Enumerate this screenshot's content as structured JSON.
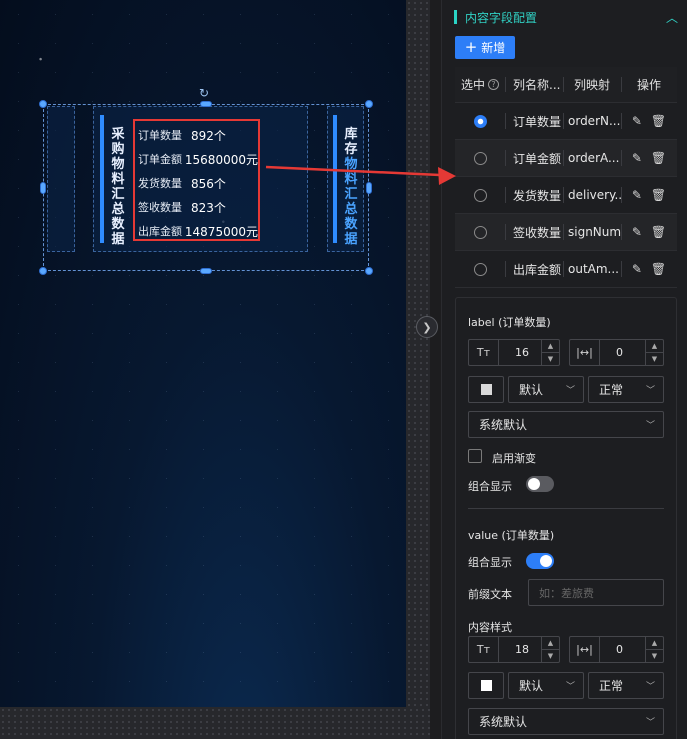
{
  "widget": {
    "left_title": "采购物料汇总数据",
    "right_title_top": "库存",
    "right_title_bottom": "物料汇总数据",
    "rows": [
      {
        "label": "订单数量",
        "value": "892个"
      },
      {
        "label": "订单金额",
        "value": "15680000元"
      },
      {
        "label": "发货数量",
        "value": "856个"
      },
      {
        "label": "签收数量",
        "value": "823个"
      },
      {
        "label": "出库金额",
        "value": "14875000元"
      }
    ]
  },
  "panel": {
    "section_title": "内容字段配置",
    "add_button": "新增",
    "table": {
      "headers": {
        "select": "选中",
        "name": "列名称...",
        "mapping": "列映射",
        "actions": "操作"
      },
      "rows": [
        {
          "name": "订单数量",
          "mapping": "orderN...",
          "selected": true
        },
        {
          "name": "订单金额",
          "mapping": "orderA...",
          "selected": false
        },
        {
          "name": "发货数量",
          "mapping": "delivery...",
          "selected": false
        },
        {
          "name": "签收数量",
          "mapping": "signNum",
          "selected": false
        },
        {
          "name": "出库金额",
          "mapping": "outAm...",
          "selected": false
        }
      ]
    },
    "label_group": {
      "title": "label (订单数量)",
      "font_icon": "Tт",
      "font_size": "16",
      "spacing_icon": "|↔|",
      "spacing": "0",
      "weight": "默认",
      "style": "正常",
      "family": "系统默认",
      "gradient_label": "启用渐变",
      "combine_label": "组合显示",
      "swatch_color": "#d9d9d9"
    },
    "value_group": {
      "title": "value (订单数量)",
      "combine_label": "组合显示",
      "prefix_label": "前缀文本",
      "prefix_placeholder": "如：差旅费",
      "content_style_label": "内容样式",
      "font_icon": "Tт",
      "font_size": "18",
      "spacing_icon": "|↔|",
      "spacing": "0",
      "weight": "默认",
      "style": "正常",
      "family": "系统默认",
      "swatch_color": "#ffffff"
    }
  }
}
